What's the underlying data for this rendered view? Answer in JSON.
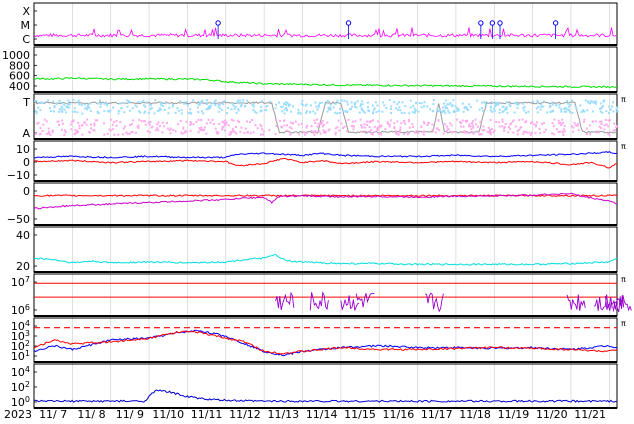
{
  "chart_data": {
    "type": "line",
    "year_label": "2023",
    "x_ticks": [
      "11/ 7",
      "11/ 8",
      "11/ 9",
      "11/10",
      "11/11",
      "11/12",
      "11/13",
      "11/14",
      "11/15",
      "11/16",
      "11/17",
      "11/18",
      "11/19",
      "11/20",
      "11/21"
    ],
    "x_range_days": [
      0,
      15.2
    ],
    "panels": [
      {
        "id": "xray-class",
        "y_ticks": [
          "X",
          "M",
          "C"
        ],
        "series": [
          {
            "color": "#ff00ff",
            "style": "flux-trace",
            "level": 0.25,
            "noise": 0.08
          },
          {
            "color": "#0000ff",
            "style": "flare-markers",
            "days": [
              4.8,
              8.2,
              11.65,
              11.95,
              12.15,
              13.6
            ]
          }
        ]
      },
      {
        "id": "wind-speed",
        "y_ticks": [
          "1000",
          "800",
          "600",
          "400"
        ],
        "ylim": [
          350,
          1100
        ],
        "series": [
          {
            "color": "#00dd00",
            "points": [
              [
                0,
                550
              ],
              [
                0.5,
                545
              ],
              [
                1,
                560
              ],
              [
                2,
                540
              ],
              [
                3,
                545
              ],
              [
                4,
                540
              ],
              [
                4.5,
                530
              ],
              [
                5,
                490
              ],
              [
                5.5,
                470
              ],
              [
                6,
                450
              ],
              [
                7,
                440
              ],
              [
                8,
                425
              ],
              [
                9,
                420
              ],
              [
                10,
                415
              ],
              [
                11,
                410
              ],
              [
                12,
                405
              ],
              [
                13,
                400
              ],
              [
                14,
                395
              ],
              [
                15,
                390
              ],
              [
                15.2,
                400
              ]
            ]
          }
        ]
      },
      {
        "id": "magnetic-sector",
        "y_ticks": [
          "T",
          "A"
        ],
        "right_label": "π",
        "series": [
          {
            "color": "#999999",
            "points": [
              [
                0,
                0.85
              ],
              [
                6.2,
                0.85
              ],
              [
                6.4,
                0.1
              ],
              [
                7.4,
                0.1
              ],
              [
                7.6,
                0.85
              ],
              [
                8.0,
                0.85
              ],
              [
                8.2,
                0.1
              ],
              [
                10.4,
                0.1
              ],
              [
                10.55,
                0.85
              ],
              [
                10.7,
                0.1
              ],
              [
                11.6,
                0.1
              ],
              [
                11.8,
                0.85
              ],
              [
                14.1,
                0.85
              ],
              [
                14.3,
                0.1
              ],
              [
                15.2,
                0.1
              ]
            ]
          },
          {
            "color": "#99ddff",
            "style": "cloud",
            "range": [
              0.6,
              0.95
            ]
          },
          {
            "color": "#ffaaee",
            "style": "cloud",
            "range": [
              0.05,
              0.45
            ]
          }
        ]
      },
      {
        "id": "imf-bz",
        "y_ticks": [
          "10",
          "0",
          "−10"
        ],
        "ylim": [
          -18,
          15
        ],
        "right_label": "π",
        "series": [
          {
            "color": "#0000ff",
            "points": [
              [
                0,
                2
              ],
              [
                1,
                3
              ],
              [
                2,
                2
              ],
              [
                3,
                3
              ],
              [
                4,
                2
              ],
              [
                5,
                2
              ],
              [
                5.3,
                5
              ],
              [
                6,
                6
              ],
              [
                6.5,
                5
              ],
              [
                7,
                4
              ],
              [
                7.5,
                6
              ],
              [
                8,
                4
              ],
              [
                9,
                3
              ],
              [
                10,
                3
              ],
              [
                11,
                4
              ],
              [
                12,
                3
              ],
              [
                13,
                4
              ],
              [
                14,
                5
              ],
              [
                14.5,
                6
              ],
              [
                15,
                7
              ],
              [
                15.2,
                6
              ]
            ]
          },
          {
            "color": "#ff0000",
            "points": [
              [
                0,
                -2
              ],
              [
                1,
                -1
              ],
              [
                2,
                -3
              ],
              [
                3,
                -2
              ],
              [
                4,
                -1
              ],
              [
                5,
                -2
              ],
              [
                5.3,
                -6
              ],
              [
                6,
                -4
              ],
              [
                6.5,
                1
              ],
              [
                7,
                -3
              ],
              [
                7.5,
                -1
              ],
              [
                8,
                -4
              ],
              [
                9,
                -2
              ],
              [
                10,
                -3
              ],
              [
                11,
                -2
              ],
              [
                12,
                -3
              ],
              [
                13,
                -2
              ],
              [
                14,
                -5
              ],
              [
                14.5,
                -3
              ],
              [
                15,
                -8
              ],
              [
                15.2,
                -4
              ]
            ]
          }
        ]
      },
      {
        "id": "dst",
        "y_ticks": [
          "0",
          "−50"
        ],
        "ylim": [
          -90,
          30
        ],
        "series": [
          {
            "color": "#ff0000",
            "points": [
              [
                0,
                -2
              ],
              [
                15.2,
                -2
              ]
            ]
          },
          {
            "color": "#cc00cc",
            "points": [
              [
                0,
                -45
              ],
              [
                0.5,
                -40
              ],
              [
                1,
                -35
              ],
              [
                2,
                -30
              ],
              [
                3,
                -25
              ],
              [
                4,
                -20
              ],
              [
                5,
                -15
              ],
              [
                5.5,
                -10
              ],
              [
                6,
                -8
              ],
              [
                6.2,
                -25
              ],
              [
                6.4,
                -5
              ],
              [
                7,
                -3
              ],
              [
                8,
                -6
              ],
              [
                9,
                -5
              ],
              [
                10,
                -7
              ],
              [
                11,
                -4
              ],
              [
                12,
                -3
              ],
              [
                13,
                0
              ],
              [
                14,
                5
              ],
              [
                14.3,
                -5
              ],
              [
                15,
                -20
              ],
              [
                15.2,
                -30
              ]
            ]
          }
        ]
      },
      {
        "id": "density",
        "y_ticks": [
          "40",
          "20"
        ],
        "ylim": [
          0,
          50
        ],
        "series": [
          {
            "color": "#00dddd",
            "points": [
              [
                0,
                14
              ],
              [
                0.5,
                12
              ],
              [
                1,
                8
              ],
              [
                1.5,
                10
              ],
              [
                2,
                8
              ],
              [
                3,
                9
              ],
              [
                4,
                8
              ],
              [
                5,
                9
              ],
              [
                5.5,
                12
              ],
              [
                6,
                14
              ],
              [
                6.3,
                18
              ],
              [
                6.6,
                10
              ],
              [
                7,
                9
              ],
              [
                8,
                7
              ],
              [
                9,
                7
              ],
              [
                10,
                6
              ],
              [
                11,
                6
              ],
              [
                12,
                6
              ],
              [
                13,
                6
              ],
              [
                14,
                7
              ],
              [
                15,
                9
              ],
              [
                15.2,
                14
              ]
            ]
          }
        ]
      },
      {
        "id": "electron-flux",
        "y_ticks": [
          "10^7",
          "10^6"
        ],
        "right_label": "π",
        "series": [
          {
            "color": "#ff0000",
            "style": "hline",
            "level": 0.78
          },
          {
            "color": "#ff0000",
            "style": "hline",
            "level": 0.45
          },
          {
            "color": "#9900cc",
            "style": "bursts",
            "days": [
              6.3,
              7.2,
              8.0,
              8.4,
              10.2,
              13.9,
              14.6,
              14.9,
              15.1
            ]
          }
        ]
      },
      {
        "id": "proton-flux",
        "y_ticks": [
          "10^4",
          "10^3",
          "10^2",
          "10^1"
        ],
        "right_label": "π",
        "series": [
          {
            "color": "#ff0000",
            "style": "dash-line",
            "level": 0.78
          },
          {
            "color": "#0000ff",
            "points": [
              [
                0,
                0.2
              ],
              [
                0.5,
                0.35
              ],
              [
                1,
                0.25
              ],
              [
                2,
                0.5
              ],
              [
                3,
                0.55
              ],
              [
                3.8,
                0.7
              ],
              [
                4.3,
                0.75
              ],
              [
                5,
                0.6
              ],
              [
                5.5,
                0.4
              ],
              [
                6,
                0.2
              ],
              [
                6.5,
                0.1
              ],
              [
                7,
                0.2
              ],
              [
                8,
                0.3
              ],
              [
                9,
                0.35
              ],
              [
                10,
                0.3
              ],
              [
                11,
                0.3
              ],
              [
                12,
                0.28
              ],
              [
                13,
                0.3
              ],
              [
                14,
                0.25
              ],
              [
                15,
                0.35
              ],
              [
                15.2,
                0.3
              ]
            ]
          },
          {
            "color": "#ff0000",
            "points": [
              [
                0,
                0.3
              ],
              [
                0.5,
                0.5
              ],
              [
                1,
                0.4
              ],
              [
                2,
                0.45
              ],
              [
                3,
                0.55
              ],
              [
                3.8,
                0.72
              ],
              [
                4.3,
                0.7
              ],
              [
                5,
                0.55
              ],
              [
                5.5,
                0.45
              ],
              [
                6,
                0.2
              ],
              [
                6.5,
                0.15
              ],
              [
                7,
                0.2
              ],
              [
                8,
                0.3
              ],
              [
                9,
                0.25
              ],
              [
                10,
                0.25
              ],
              [
                11,
                0.28
              ],
              [
                12,
                0.3
              ],
              [
                13,
                0.28
              ],
              [
                14,
                0.25
              ],
              [
                15,
                0.2
              ],
              [
                15.2,
                0.25
              ]
            ]
          }
        ]
      },
      {
        "id": "gamma-index",
        "y_ticks": [
          "10^4",
          "10^2",
          "10^0"
        ],
        "series": [
          {
            "color": "#0000cc",
            "points": [
              [
                0,
                0.1
              ],
              [
                2.9,
                0.1
              ],
              [
                3.0,
                0.25
              ],
              [
                3.2,
                0.38
              ],
              [
                3.5,
                0.35
              ],
              [
                4.0,
                0.22
              ],
              [
                4.5,
                0.15
              ],
              [
                5,
                0.12
              ],
              [
                6,
                0.1
              ],
              [
                15.2,
                0.1
              ]
            ]
          }
        ]
      }
    ]
  }
}
